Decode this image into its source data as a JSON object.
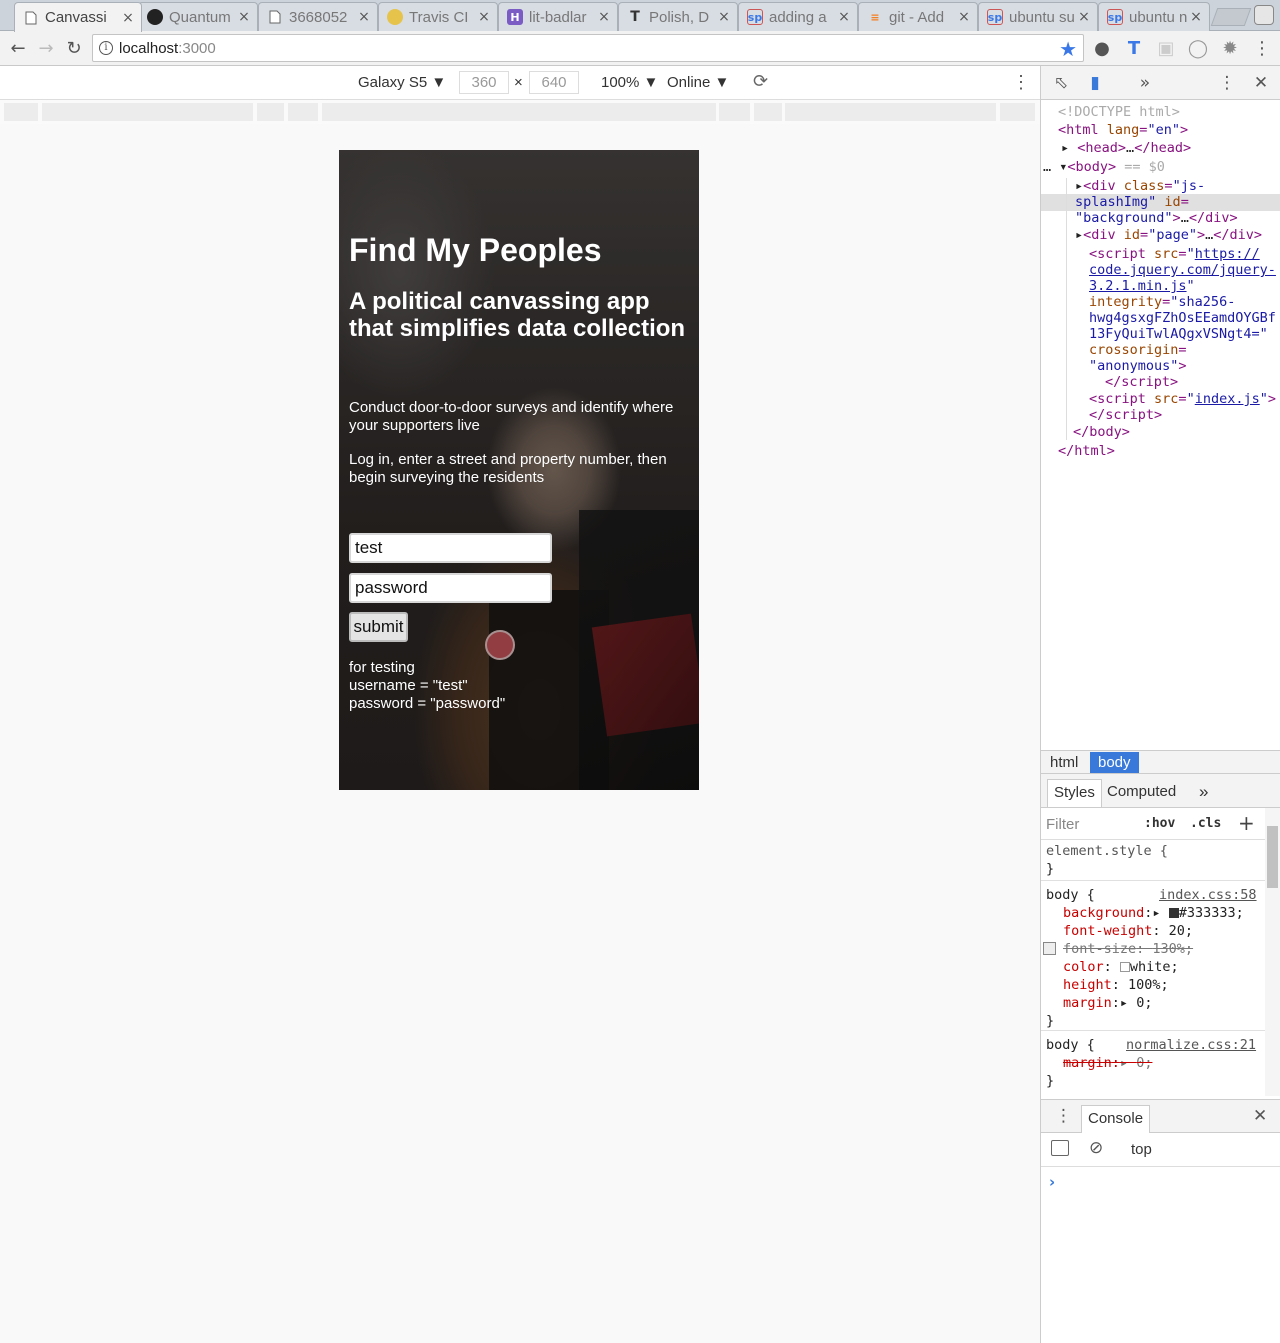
{
  "tabs": [
    {
      "label": "Canvassi",
      "icon": "page-icon",
      "active": true
    },
    {
      "label": "Quantum",
      "icon": "github-icon"
    },
    {
      "label": "3668052",
      "icon": "page-icon"
    },
    {
      "label": "Travis CI",
      "icon": "travis-icon"
    },
    {
      "label": "lit-badlar",
      "icon": "h-icon"
    },
    {
      "label": "Polish, D",
      "icon": "t-icon"
    },
    {
      "label": "adding a",
      "icon": "sp-icon"
    },
    {
      "label": "git - Add",
      "icon": "stackoverflow-icon"
    },
    {
      "label": "ubuntu su",
      "icon": "sp-icon"
    },
    {
      "label": "ubuntu n",
      "icon": "sp-icon"
    }
  ],
  "tab_close": "×",
  "address": {
    "host": "localhost",
    "port": ":3000"
  },
  "device_toolbar": {
    "device": "Galaxy S5",
    "width": "360",
    "times": "×",
    "height": "640",
    "zoom": "100%",
    "network": "Online"
  },
  "page": {
    "title": "Find My Peoples",
    "subtitle": "A political canvassing app that simplifies data collection",
    "paragraph1": "Conduct door-to-door surveys and identify where your supporters live",
    "paragraph2": "Log in, enter a street and property number, then begin surveying the residents",
    "username_value": "test",
    "password_value": "password",
    "submit_label": "submit",
    "note_line1": "for testing",
    "note_line2": "username = \"test\"",
    "note_line3": "password = \"password\""
  },
  "devtools": {
    "crumbs": [
      "html",
      "body"
    ],
    "style_tabs": [
      "Styles",
      "Computed"
    ],
    "filter_placeholder": "Filter",
    "hov": ":hov",
    "cls": ".cls",
    "console_tab": "Console",
    "console_context": "top",
    "dollar0": "== $0",
    "rules": {
      "element_style": "element.style {",
      "body1_selector": "body {",
      "body1_source": "index.css:58",
      "body1_props": [
        {
          "name": "background",
          "value": "#333333;"
        },
        {
          "name": "font-weight",
          "value": "20;"
        },
        {
          "name": "font-size",
          "value": "130%;"
        },
        {
          "name": "color",
          "value": "white;"
        },
        {
          "name": "height",
          "value": "100%;"
        },
        {
          "name": "margin",
          "value": "0;"
        }
      ],
      "body2_selector": "body {",
      "body2_source": "normalize.css:21",
      "body2_props": [
        {
          "name": "margin",
          "value": "0;"
        }
      ],
      "close_brace": "}"
    },
    "dom": {
      "doctype": "<!DOCTYPE html>",
      "script1_src": "https://code.jquery.com/jquery-3.2.1.min.js",
      "script1_integrity": "sha256-hwg4gsxgFZhOsEEamdOYGBf13FyQuiTwlAQgxVSNgt4=",
      "script1_crossorigin": "anonymous",
      "script2_src": "index.js"
    }
  },
  "colors": {
    "accent": "#3879d9",
    "body_bg": "#333333"
  }
}
